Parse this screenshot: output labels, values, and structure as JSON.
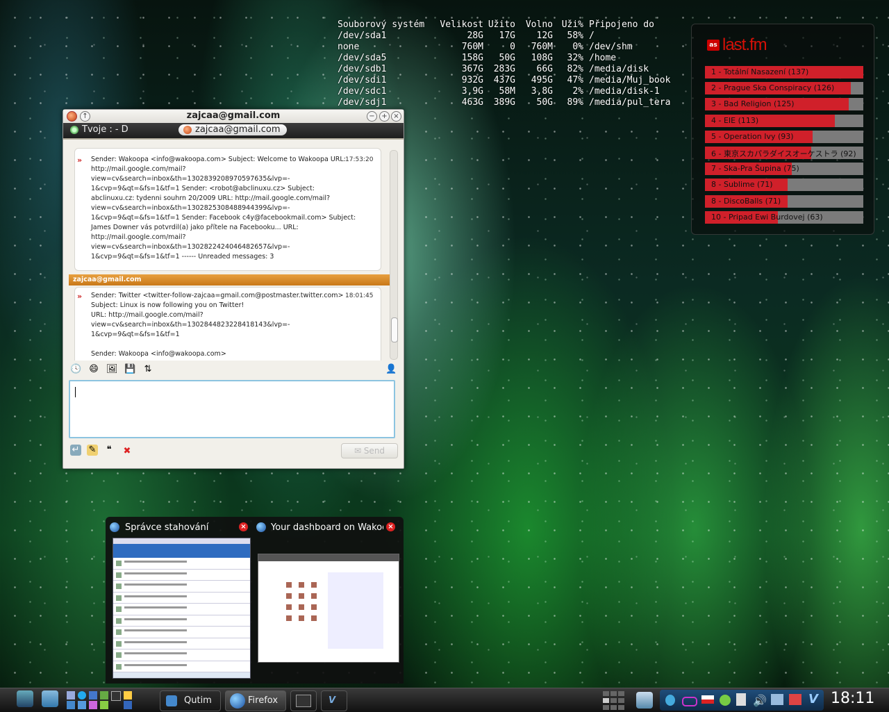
{
  "df": {
    "header": [
      "Souborový systém",
      "Velikost",
      "Užito",
      "Volno",
      "Uži%",
      "Připojeno do"
    ],
    "rows": [
      [
        "/dev/sda1",
        "28G",
        "17G",
        "12G",
        "58%",
        "/"
      ],
      [
        "none",
        "760M",
        "0",
        "760M",
        "0%",
        "/dev/shm"
      ],
      [
        "/dev/sda5",
        "158G",
        "50G",
        "108G",
        "32%",
        "/home"
      ],
      [
        "/dev/sdb1",
        "367G",
        "283G",
        "66G",
        "82%",
        "/media/disk"
      ],
      [
        "/dev/sdi1",
        "932G",
        "437G",
        "495G",
        "47%",
        "/media/Muj_book"
      ],
      [
        "/dev/sdc1",
        "3,9G",
        "58M",
        "3,8G",
        "2%",
        "/media/disk-1"
      ],
      [
        "/dev/sdj1",
        "463G",
        "389G",
        "50G",
        "89%",
        "/media/pul_tera"
      ]
    ]
  },
  "lastfm": {
    "logo_badge": "as",
    "logo_text": "last.fm",
    "items": [
      {
        "label": "1 - Totální Nasazení (137)",
        "fill": 1.0
      },
      {
        "label": "2 - Prague Ska Conspiracy (126)",
        "fill": 0.92
      },
      {
        "label": "3 - Bad Religion (125)",
        "fill": 0.91
      },
      {
        "label": "4 - EIE (113)",
        "fill": 0.82
      },
      {
        "label": "5 - Operation Ivy (93)",
        "fill": 0.68
      },
      {
        "label": "6 - 東京スカパラダイスオーケストラ (92)",
        "fill": 0.67
      },
      {
        "label": "7 - Ska-Pra Šupina (75)",
        "fill": 0.55
      },
      {
        "label": "8 - Sublime (71)",
        "fill": 0.52
      },
      {
        "label": "8 - DiscoBalls (71)",
        "fill": 0.52
      },
      {
        "label": "10 - Pripad Ewi Burdovej (63)",
        "fill": 0.46
      }
    ]
  },
  "chat": {
    "window_title": "zajcaa@gmail.com",
    "status_label": "Tvoje : - D",
    "tab_label": "zajcaa@gmail.com",
    "message1": {
      "time": "17:53:20",
      "lines": [
        "Sender: Wakoopa <info@wakoopa.com> Subject: Welcome to Wakoopa URL:",
        "http://mail.google.com/mail?",
        "view=cv&search=inbox&th=1302839208970597635&lvp=-",
        "1&cvp=9&qt=&fs=1&tf=1 Sender: <robot@abclinuxu.cz> Subject:",
        "abclinuxu.cz: tydenni souhrn 20/2009 URL: http://mail.google.com/mail?",
        "view=cv&search=inbox&th=1302825308488944399&lvp=-",
        "1&cvp=9&qt=&fs=1&tf=1 Sender: Facebook c4y@facebookmail.com> Subject:",
        "James Downer vás potvrdil(a) jako přítele na Facebooku... URL:",
        "http://mail.google.com/mail?",
        "view=cv&search=inbox&th=1302822424046482657&lvp=-",
        "1&cvp=9&qt=&fs=1&tf=1 ------ Unreaded messages: 3"
      ]
    },
    "sender_header": "zajcaa@gmail.com",
    "message2": {
      "time": "18:01:45",
      "lines": [
        "Sender: Twitter <twitter-follow-zajcaa=gmail.com@postmaster.twitter.com>",
        "Subject: Linux is now following you on Twitter!",
        "URL: http://mail.google.com/mail?",
        "view=cv&search=inbox&th=1302844823228418143&lvp=-",
        "1&cvp=9&qt=&fs=1&tf=1",
        "",
        "Sender: Wakoopa <info@wakoopa.com>"
      ]
    },
    "send_label": "Send"
  },
  "switcher": {
    "item1": "Správce stahování",
    "item2": "Your dashboard on Wakoopa"
  },
  "panel": {
    "task_qutim": "Qutim",
    "task_firefox": "Firefox",
    "clock": "18:11"
  }
}
